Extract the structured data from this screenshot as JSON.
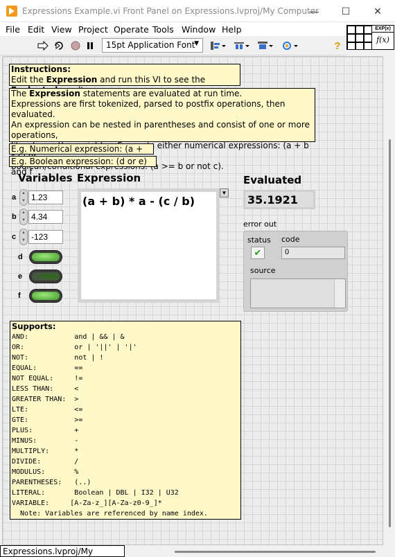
{
  "window": {
    "title": "Expressions Example.vi Front Panel on Expressions.lvproj/My Computer",
    "minimize": "—",
    "maximize": "☐",
    "close": "✕"
  },
  "menu": [
    "File",
    "Edit",
    "View",
    "Project",
    "Operate",
    "Tools",
    "Window",
    "Help"
  ],
  "toolbar": {
    "font": "15pt Application Font",
    "icons": [
      "run-arrow-icon",
      "run-continuously-icon",
      "abort-icon",
      "pause-icon",
      "align-objects-icon",
      "distribute-objects-icon",
      "resize-objects-icon",
      "reorder-icon",
      "help-icon"
    ],
    "help": "?"
  },
  "vi_icon": {
    "top": "EXP(x)",
    "fx": "f(x)"
  },
  "instructions": {
    "title": "Instructions:",
    "line_pre": "Edit the ",
    "line_bold1": "Expression",
    "line_mid": " and run this VI to see the ",
    "line_bold2": "Evaluated",
    "line_post": " result."
  },
  "description": {
    "l1_pre": "The ",
    "l1_bold": "Expression",
    "l1_post": " statements are evaluated at run time.",
    "l2": "Expressions are first tokenized, parsed to postfix operations, then evaluated.",
    "l3": "An expression can be nested in parentheses and consist of one or more operations,",
    "l4": "literals, and/or variables. Supports either numerical expressions: (a + b * c) or",
    "l5": "boolean/conditional expressions: (a >= b or not c)."
  },
  "example_numerical": "E.g. Numerical expression:    (a + b) * c",
  "example_boolean": "E.g. Boolean expression:    (d or e) and f",
  "variables": {
    "label": "Variables",
    "numeric": [
      {
        "name": "a",
        "value": "1.23"
      },
      {
        "name": "b",
        "value": "4.34"
      },
      {
        "name": "c",
        "value": "-123"
      }
    ],
    "boolean": [
      {
        "name": "d",
        "value": true
      },
      {
        "name": "e",
        "value": false
      },
      {
        "name": "f",
        "value": true
      }
    ]
  },
  "expression": {
    "label": "Expression",
    "value": "(a + b) * a - (c / b)"
  },
  "evaluated": {
    "label": "Evaluated",
    "value": "35.1921"
  },
  "error_out": {
    "label": "error out",
    "status_label": "status",
    "status_glyph": "✔",
    "code_label": "code",
    "code_value": "0",
    "source_label": "source"
  },
  "supports": {
    "title": "Supports:",
    "lines": [
      "AND:           and | && | &",
      "OR:            or | '||' | '|'",
      "NOT:           not | !",
      "EQUAL:         ==",
      "NOT EQUAL:     !=",
      "LESS THAN:     <",
      "GREATER THAN:  >",
      "LTE:           <=",
      "GTE:           >=",
      "PLUS:          +",
      "MINUS:         -",
      "MULTIPLY:      *",
      "DIVIDE:        /",
      "MODULUS:       %",
      "PARENTHESES:   (..)",
      "LITERAL:       Boolean | DBL | I32 | U32",
      "VARIABLE:     [A-Za-z_][A-Za-z0-9_]*",
      "  Note: Variables are referenced by name index."
    ]
  },
  "statusbar": "Expressions.lvproj/My Computer"
}
